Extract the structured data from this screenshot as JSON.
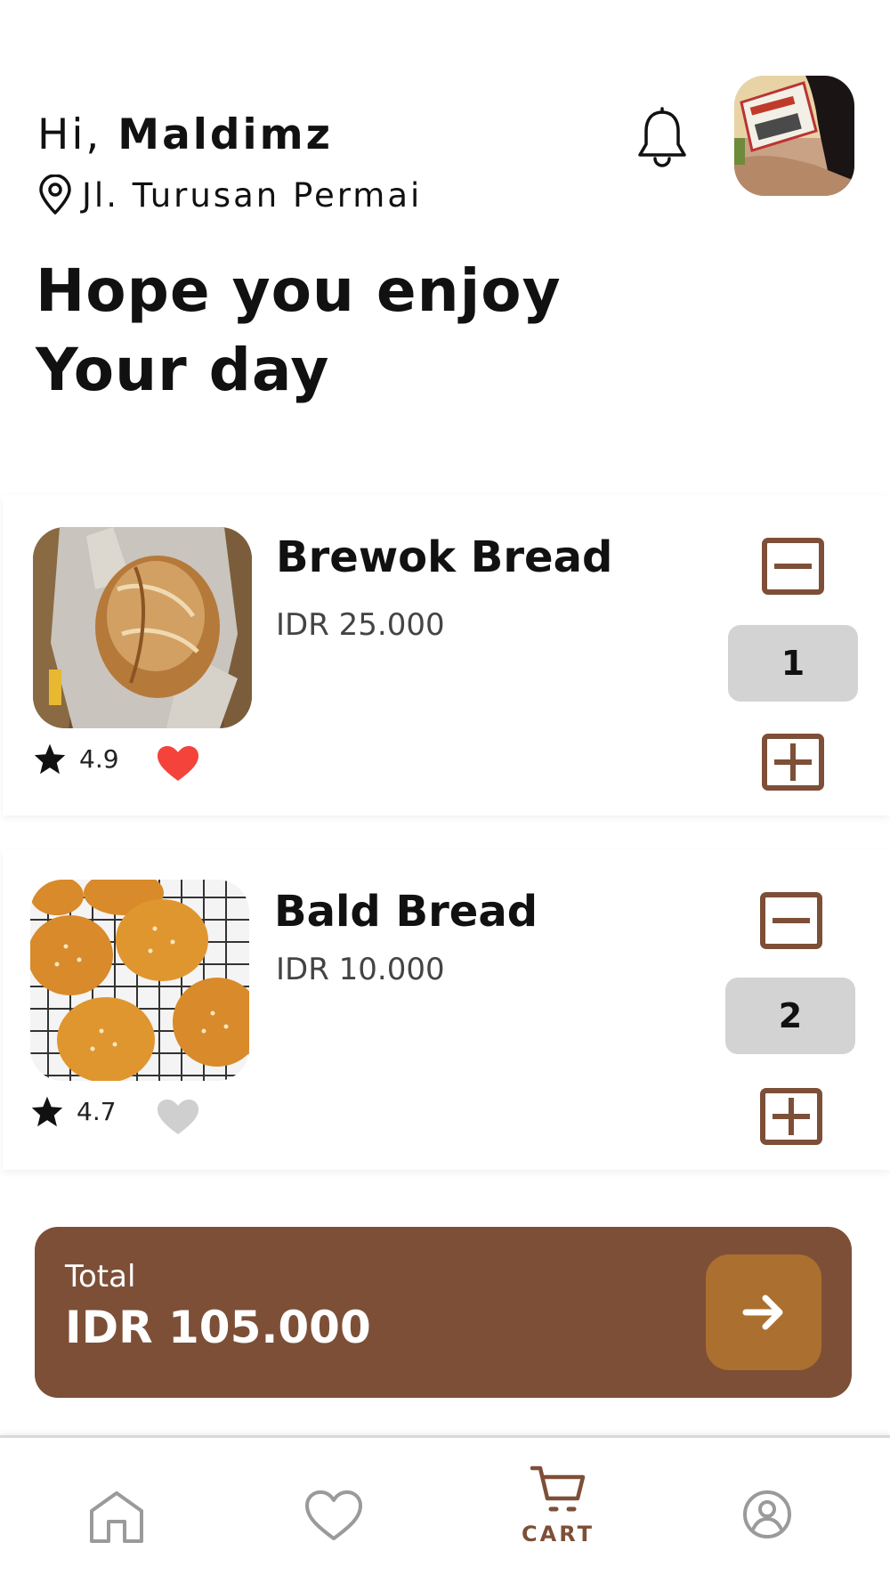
{
  "header": {
    "greeting_prefix": "Hi,",
    "user_name": "Maldimz",
    "location": "Jl. Turusan Permai",
    "headline_line1": "Hope you enjoy",
    "headline_line2": "Your day"
  },
  "cart_items": [
    {
      "name": "Brewok Bread",
      "price": "IDR 25.000",
      "rating": "4.9",
      "favorite": true,
      "quantity": "1"
    },
    {
      "name": "Bald Bread",
      "price": "IDR 10.000",
      "rating": "4.7",
      "favorite": false,
      "quantity": "2"
    }
  ],
  "total": {
    "label": "Total",
    "amount": "IDR 105.000"
  },
  "bottom_nav": {
    "items": [
      {
        "icon": "home-icon",
        "label": ""
      },
      {
        "icon": "heart-icon",
        "label": ""
      },
      {
        "icon": "cart-icon",
        "label": "CART",
        "active": true
      },
      {
        "icon": "profile-icon",
        "label": ""
      }
    ]
  },
  "colors": {
    "brand_brown": "#7d4f37",
    "accent_orange": "#ab6f2f",
    "favorite_red": "#f4433a",
    "favorite_off": "#cfcfcf",
    "qty_background": "#d3d3d3"
  }
}
